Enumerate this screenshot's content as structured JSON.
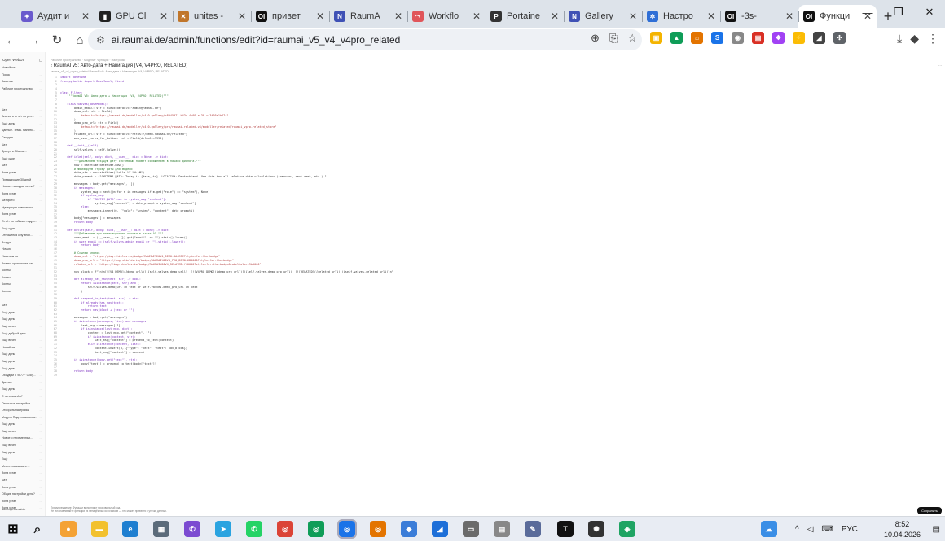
{
  "browser": {
    "tabs": [
      {
        "label": "Аудит и",
        "fav_color": "#6a5acd",
        "fav_glyph": "✦"
      },
      {
        "label": "GPU Cl",
        "fav_color": "#222222",
        "fav_glyph": "▮"
      },
      {
        "label": "unites -",
        "fav_color": "#c0762b",
        "fav_glyph": "✕"
      },
      {
        "label": "привет",
        "fav_color": "#111111",
        "fav_glyph": "OI"
      },
      {
        "label": "RaumA",
        "fav_color": "#3f51b5",
        "fav_glyph": "N"
      },
      {
        "label": "Workflo",
        "fav_color": "#e0555a",
        "fav_glyph": "⤳"
      },
      {
        "label": "Portaine",
        "fav_color": "#333333",
        "fav_glyph": "P"
      },
      {
        "label": "Gallery",
        "fav_color": "#3f51b5",
        "fav_glyph": "N"
      },
      {
        "label": "Настро",
        "fav_color": "#2f6fd6",
        "fav_glyph": "✲"
      },
      {
        "label": "-3s-",
        "fav_color": "#111111",
        "fav_glyph": "OI"
      },
      {
        "label": "Функци",
        "fav_color": "#111111",
        "fav_glyph": "OI",
        "active": true
      }
    ],
    "url_prefix": "ai.raumai.de",
    "url_path": "/admin/functions/edit?id=raumai_v5_v4_v4pro_related",
    "new_tab_label": "+"
  },
  "sidebar": {
    "header": "Open WebUI",
    "items": [
      "Новый чат",
      "Поиск",
      "Заметки",
      "Рабочее пространство",
      "",
      "",
      "Чат",
      "Анализ и отчёт по рез...",
      "Ещё день",
      "Данные. Темы. Напитк...",
      "Сегодня",
      "Чат",
      "Доступ в Ollama ...",
      "Ещё один",
      "Чат",
      "Зона устан",
      "Предыдущие 30 дней",
      "Новая - находим песни?",
      "Зона устан",
      "Чат фото",
      "Нумерация зависимых...",
      "Зона устан",
      "Отчёт по таблице подро...",
      "Ещё один",
      "Отношения к чу эпох...",
      "Воздух",
      "Ночью",
      "Изменим ли",
      "Анализ хронологии чат...",
      "Коллы",
      "Коллы",
      "Коллы",
      "Коллы",
      "",
      "Чат",
      "Ещё день",
      "Ещё день",
      "Ещё вечер",
      "Ещё добрый день",
      "Ещё вечер",
      "Новый чат",
      "Ещё день",
      "Ещё день",
      "Ещё день",
      "Обсудим о 'IE777' Обсу...",
      "Данные",
      "Ещё день",
      "С чего начнём?",
      "Открытые настройки...",
      "Отобрать настройки",
      "Модуль Подготовка соза...",
      "Ещё день",
      "Ещё вечер",
      "Новое о переменных...",
      "Ещё вечер",
      "Ещё день",
      "Ещё",
      "Место показывать ...",
      "Зона устан",
      "Чат",
      "Зона устан",
      "Общие настройки дела?",
      "Зона устан",
      "Зона устан"
    ],
    "user": "admin@raumai.de"
  },
  "editor": {
    "breadcrumb": "Рабочее пространство · Модели · Функции · Настройки",
    "title": "RaumAI v5: Авто-дата + Навигация (V4, V4PRO, RELATED)",
    "subtitle": "raumai_v5_v4_v4pro_related  RaumAI v5: Авто-дата + Навигация (V4, V4PRO, RELATED)",
    "more_label": "···",
    "save_label": "Сохранить",
    "footer_lines": [
      "Предупреждение: Функции выполняют произвольный код.",
      "Не устанавливайте функции из ненадёжных источников — это может привести к утечке данных."
    ],
    "code": [
      "import datetime",
      "from pydantic import BaseModel, Field",
      "",
      "",
      "class Filter:",
      "    \"\"\"RaumAI V5: Авто-дата + Навигация (V4, V4PRO, RELATED)\"\"\"",
      "",
      "    class Valves(BaseModel):",
      "        admin_email: str = Field(default=\"admin@raumai.de\")",
      "        demo_url: str = Field(",
      "            default=\"https://raumai.de/modeller/v4.0.gallery/c8d45071-b43c-4c09-a138-c43f95e1b67f\"",
      "        )",
      "        demo_pro_url: str = Field(",
      "            default=\"https://raumai.de/modeller/v4.0.gallery/pro/raumai-related-v4/modeller/related/raumai_vpro-related_store\"",
      "        )",
      "        related_url: str = Field(default=\"https://demo.raumai.de/related\")",
      "        max_user_turns_for_button: int = Field(default=9999)",
      "",
      "    def __init__(self):",
      "        self.valves = self.Valves()",
      "",
      "    def inlet(self, body: dict, __user__: dict = None) -> dict:",
      "        \"\"\"Добавляем текущую дату системным промпт-сообщением в начало диалога.\"\"\"",
      "        now = datetime.datetime.now()",
      "        # Формируем строку даты для модели",
      "        date_str = now.strftime(\"%d.%m.%Y %H:%M\")",
      "        date_prompt = f\"СИСТЕМА ДАТА: Today is {date_str}. LOCATION: Deutschland. Use this for all relative date calculations (tomorrow, next week, etc.).\"",
      "",
      "        messages = body.get(\"messages\", [])",
      "        if messages:",
      "            system_msg = next((m for m in messages if m.get(\"role\") == \"system\"), None)",
      "            if system_msg:",
      "                if \"СИСТЕМ ДАТА\" not in system_msg[\"content\"]:",
      "                    system_msg[\"content\"] = date_prompt + system_msg[\"content\"]",
      "            else:",
      "                messages.insert(0, {\"role\": \"system\", \"content\": date_prompt})",
      "",
      "        body[\"messages\"] = messages",
      "        return body",
      "",
      "    def outlet(self, body: dict, __user__: dict = None) -> dict:",
      "        \"\"\"Добавляем три навигационные кнопки в ответ AI.\"\"\"",
      "        user_email = ((__user__ or {}).get(\"email\") or \"\").strip().lower()",
      "        if user_email == (self.valves.admin_email or \"\").strip().lower():",
      "            return body",
      "",
      "        # Ссылки кнопок",
      "        demo_url = \"https://img.shields.io/badge/RAUMAI%20V4_DEMO-0A4E8C?style=for-the-badge\"",
      "        demo_pro_url = \"https://img.shields.io/badge/RAUMAI%20V4_PRO_DEMO-6B0000?style=for-the-badge\"",
      "        related_url = \"https://img.shields.io/badge/RAUMAI%20V4_RELATED-ff0000?style=for-the-badge&labelColor=9b0000\"",
      "",
      "        nav_block = f\"\\n\\n[![V4 DEMO]({demo_url})]({self.valves.demo_url})  [![V4PRO DEMO]({demo_pro_url})]({self.valves.demo_pro_url})  [![RELATED]({related_url})]({self.valves.related_url})\\n\"",
      "",
      "        def already_has_nav(text: str) -> bool:",
      "            return isinstance(text, str) and (",
      "                self.valves.demo_url in text or self.valves.demo_pro_url in text",
      "            )",
      "",
      "        def prepend_to_text(text: str) -> str:",
      "            if already_has_nav(text):",
      "                return text",
      "            return nav_block + (text or \"\")",
      "",
      "        messages = body.get(\"messages\")",
      "        if isinstance(messages, list) and messages:",
      "            last_msg = messages[-1]",
      "            if isinstance(last_msg, dict):",
      "                content = last_msg.get(\"content\", \"\")",
      "                if isinstance(content, str):",
      "                    last_msg[\"content\"] = prepend_to_text(content)",
      "                elif isinstance(content, list):",
      "                    content.insert(0, {\"type\": \"text\", \"text\": nav_block})",
      "                    last_msg[\"content\"] = content",
      "",
      "        if isinstance(body.get(\"text\"), str):",
      "            body[\"text\"] = prepend_to_text(body[\"text\"])",
      "",
      "        return body",
      ""
    ]
  },
  "taskbar": {
    "lang": "РУС",
    "time": "8:52",
    "date": "10.04.2026"
  }
}
